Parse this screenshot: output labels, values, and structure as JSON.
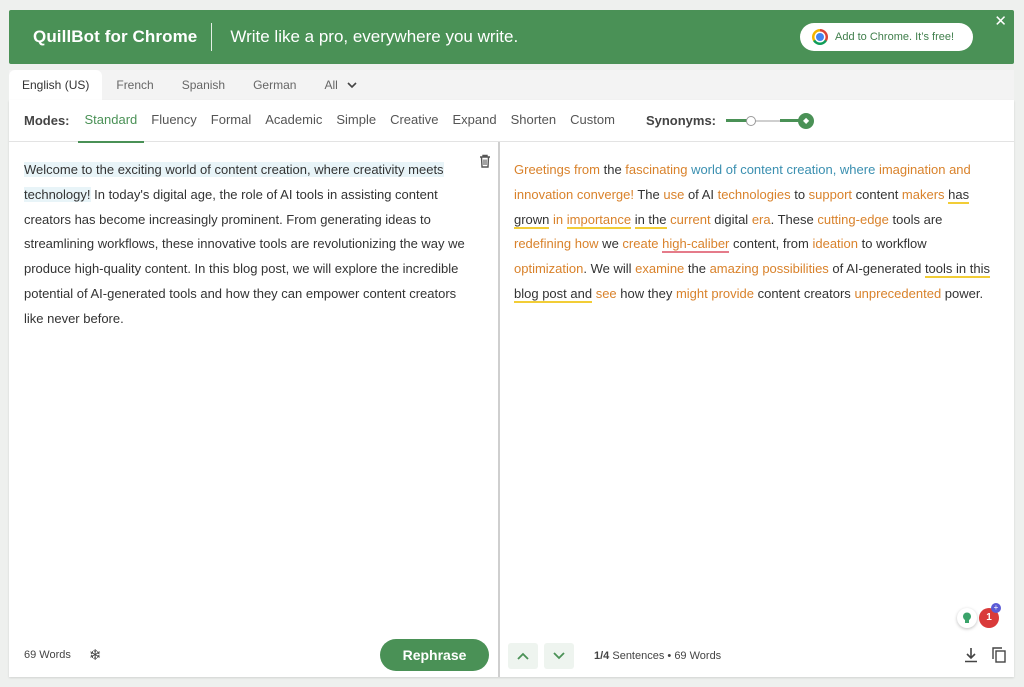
{
  "banner": {
    "brand": "QuillBot for Chrome",
    "tagline": "Write like a pro, everywhere you write.",
    "cta": "Add to Chrome. It’s free!",
    "close": "✕"
  },
  "languages": {
    "tabs": [
      "English (US)",
      "French",
      "Spanish",
      "German",
      "All"
    ],
    "active": "English (US)"
  },
  "modes": {
    "label": "Modes:",
    "items": [
      "Standard",
      "Fluency",
      "Formal",
      "Academic",
      "Simple",
      "Creative",
      "Expand",
      "Shorten",
      "Custom"
    ],
    "active": "Standard",
    "synonyms_label": "Synonyms:",
    "synonyms_level": 0.33
  },
  "input": {
    "highlighted": "Welcome to the exciting world of content creation, where creativity meets technology!",
    "rest": " In today's digital age, the role of AI tools in assisting content creators has become increasingly prominent. From generating ideas to streamlining workflows, these innovative tools are revolutionizing the way we produce high-quality content. In this blog post, we will explore the incredible potential of AI-generated tools and how they can empower content creators like never before.",
    "word_count": "69 Words",
    "rephrase_label": "Rephrase"
  },
  "output": {
    "segments": [
      {
        "t": "Greetings from",
        "c": "o"
      },
      {
        "t": " the ",
        "c": ""
      },
      {
        "t": "fascinating",
        "c": "o"
      },
      {
        "t": " ",
        "c": ""
      },
      {
        "t": "world of content creation, where",
        "c": "b"
      },
      {
        "t": " ",
        "c": ""
      },
      {
        "t": "imagination and innovation converge!",
        "c": "o"
      },
      {
        "t": " The ",
        "c": ""
      },
      {
        "t": "use",
        "c": "o"
      },
      {
        "t": " of AI ",
        "c": ""
      },
      {
        "t": "technologies",
        "c": "o"
      },
      {
        "t": " to ",
        "c": ""
      },
      {
        "t": "support",
        "c": "o"
      },
      {
        "t": " content ",
        "c": ""
      },
      {
        "t": "makers",
        "c": "o"
      },
      {
        "t": " ",
        "c": ""
      },
      {
        "t": "has grown",
        "c": "uy"
      },
      {
        "t": " in ",
        "c": "o"
      },
      {
        "t": "importance",
        "c": "o uy"
      },
      {
        "t": " ",
        "c": ""
      },
      {
        "t": "in the",
        "c": "uy"
      },
      {
        "t": " ",
        "c": ""
      },
      {
        "t": "current",
        "c": "o"
      },
      {
        "t": " digital ",
        "c": ""
      },
      {
        "t": "era",
        "c": "o"
      },
      {
        "t": ". These ",
        "c": ""
      },
      {
        "t": "cutting-edge",
        "c": "o"
      },
      {
        "t": " tools are ",
        "c": ""
      },
      {
        "t": "redefining how",
        "c": "o"
      },
      {
        "t": " we ",
        "c": ""
      },
      {
        "t": "create",
        "c": "o"
      },
      {
        "t": " ",
        "c": ""
      },
      {
        "t": "high-caliber",
        "c": "o ur"
      },
      {
        "t": " content, from ",
        "c": ""
      },
      {
        "t": "ideation",
        "c": "o"
      },
      {
        "t": " to workflow ",
        "c": ""
      },
      {
        "t": "optimization",
        "c": "o"
      },
      {
        "t": ". We will ",
        "c": ""
      },
      {
        "t": "examine",
        "c": "o"
      },
      {
        "t": " the ",
        "c": ""
      },
      {
        "t": "amazing possibilities",
        "c": "o"
      },
      {
        "t": " of AI-generated ",
        "c": ""
      },
      {
        "t": "tools in this blog post and",
        "c": "uy"
      },
      {
        "t": " ",
        "c": ""
      },
      {
        "t": "see",
        "c": "o"
      },
      {
        "t": " how they ",
        "c": ""
      },
      {
        "t": "might provide",
        "c": "o"
      },
      {
        "t": " content creators ",
        "c": ""
      },
      {
        "t": "unprecedented",
        "c": "o"
      },
      {
        "t": " power.",
        "c": ""
      }
    ],
    "sentences": "1/4",
    "sentences_label": "Sentences",
    "word_count": "69 Words",
    "badge_count": "1"
  },
  "colors": {
    "brand_green": "#4a9156",
    "changed_word": "#d9822b",
    "structure_change": "#3a8fb0",
    "longest_unchanged": "#f2cd36"
  },
  "icons": {
    "trash": "trash-icon",
    "freeze": "snowflake-icon",
    "prev": "chevron-up-icon",
    "next": "chevron-down-icon",
    "download": "download-icon",
    "copy": "copy-icon"
  }
}
